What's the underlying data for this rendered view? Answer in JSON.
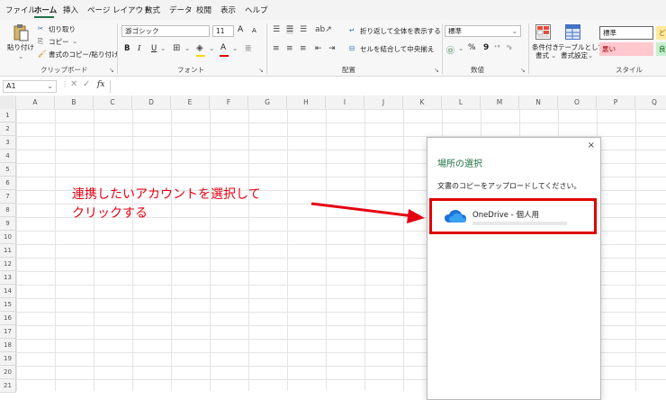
{
  "menu": {
    "tabs": [
      "ファイル",
      "ホーム",
      "挿入",
      "ページ レイアウト",
      "数式",
      "データ",
      "校閲",
      "表示",
      "ヘルプ"
    ],
    "active": "ホーム"
  },
  "ribbon": {
    "clipboard": {
      "paste": "貼り付け",
      "cut": "切り取り",
      "copy": "コピー",
      "format_painter": "書式のコピー/貼り付け",
      "label": "クリップボード"
    },
    "font": {
      "font_name": "游ゴシック",
      "font_size": "11",
      "grow": "A",
      "shrink": "A",
      "bold": "B",
      "italic": "I",
      "underline": "U",
      "font_color": "A",
      "label": "フォント"
    },
    "alignment": {
      "wrap_text": "折り返して全体を表示する",
      "merge_center": "セルを結合して中央揃え",
      "label": "配置"
    },
    "number": {
      "format": "標準",
      "percent": "%",
      "comma": "9",
      "label": "数値"
    },
    "styles": {
      "conditional_line1": "条件付き",
      "conditional_line2": "書式",
      "table_line1": "テーブルとして",
      "table_line2": "書式設定",
      "style_normal": "標準",
      "style_bad": "悪い",
      "style_good_partial": "良",
      "style_neutral_partial": "ど",
      "label": "スタイル"
    }
  },
  "formula_bar": {
    "name_box": "A1",
    "fx": "fx",
    "value": ""
  },
  "grid": {
    "columns": [
      "A",
      "B",
      "C",
      "D",
      "E",
      "F",
      "G",
      "H",
      "I",
      "J",
      "K",
      "L",
      "M",
      "N",
      "O",
      "P",
      "Q"
    ],
    "rows": [
      "1",
      "2",
      "3",
      "4",
      "5",
      "6",
      "7",
      "8",
      "9",
      "10",
      "11",
      "12",
      "13",
      "14",
      "15",
      "16",
      "17",
      "18",
      "19",
      "20",
      "21"
    ]
  },
  "annotation": {
    "line1": "連携したいアカウントを選択して",
    "line2": "クリックする"
  },
  "dialog": {
    "close": "×",
    "title": "場所の選択",
    "instruction": "文書のコピーをアップロードしてください。",
    "option_label": "OneDrive - 個人用"
  },
  "colors": {
    "excel_green": "#217346",
    "annotation_red": "#e60012",
    "onedrive_blue": "#1e73d8",
    "bad_style_bg": "#ffc7ce",
    "good_style_bg": "#c6efce",
    "neutral_style_bg": "#ffeb9c"
  }
}
